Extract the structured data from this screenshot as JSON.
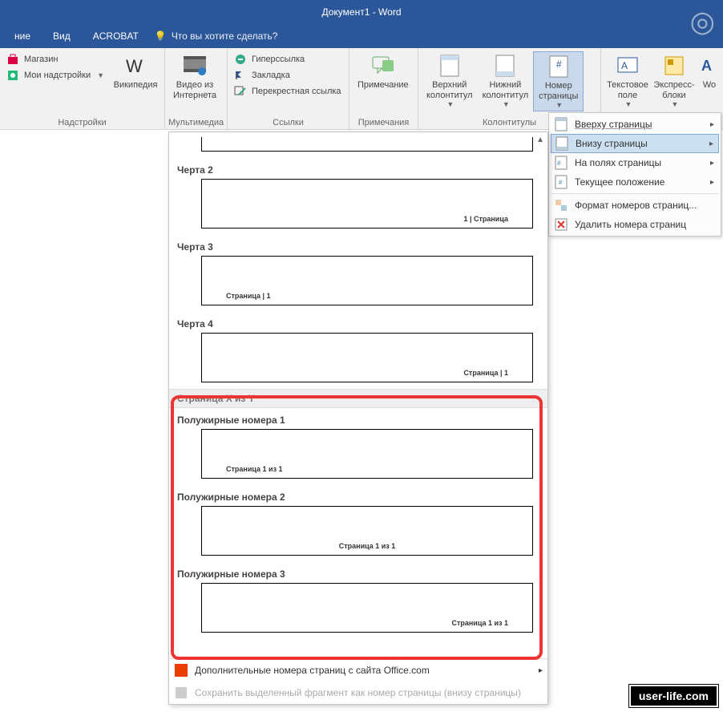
{
  "title": "Документ1 - Word",
  "menubar": {
    "items": [
      "ние",
      "Вид",
      "ACROBAT"
    ],
    "tellme": "Что вы хотите сделать?"
  },
  "ribbon": {
    "addins": {
      "label": "Надстройки",
      "store": "Магазин",
      "my": "Мои надстройки",
      "wiki": "Википедия"
    },
    "media": {
      "label": "Мультимедиа",
      "video": "Видео из\nИнтернета"
    },
    "links": {
      "label": "Ссылки",
      "hyper": "Гиперссылка",
      "bookmark": "Закладка",
      "cross": "Перекрестная ссылка"
    },
    "comments": {
      "label": "Примечания",
      "comment": "Примечание"
    },
    "hf": {
      "label": "Колонтитулы",
      "header": "Верхний\nколонтитул",
      "footer": "Нижний\nколонтитул",
      "pagenum": "Номер\nстраницы"
    },
    "text": {
      "textbox": "Текстовое\nполе",
      "quick": "Экспресс-\nблоки",
      "wa": "Wo"
    }
  },
  "pnMenu": {
    "top": "Вверху страницы",
    "bottom": "Внизу страницы",
    "margins": "На полях страницы",
    "current": "Текущее положение",
    "format": "Формат номеров страниц...",
    "remove": "Удалить номера страниц"
  },
  "gallery": {
    "items": {
      "l2": "Черта 2",
      "l2n": "1 | Страница",
      "l3": "Черта 3",
      "l3n": "Страница | 1",
      "l4": "Черта 4",
      "l4n": "Страница | 1",
      "secXY": "Страница X из Y",
      "b1": "Полужирные номера 1",
      "b1n": "Страница 1 из 1",
      "b2": "Полужирные номера 2",
      "b2n": "Страница 1 из 1",
      "b3": "Полужирные номера 3",
      "b3n": "Страница 1 из 1"
    },
    "moreOffice": "Дополнительные номера страниц с сайта Office.com",
    "saveSel": "Сохранить выделенный фрагмент как номер страницы (внизу страницы)"
  },
  "watermark": "user-life.com"
}
